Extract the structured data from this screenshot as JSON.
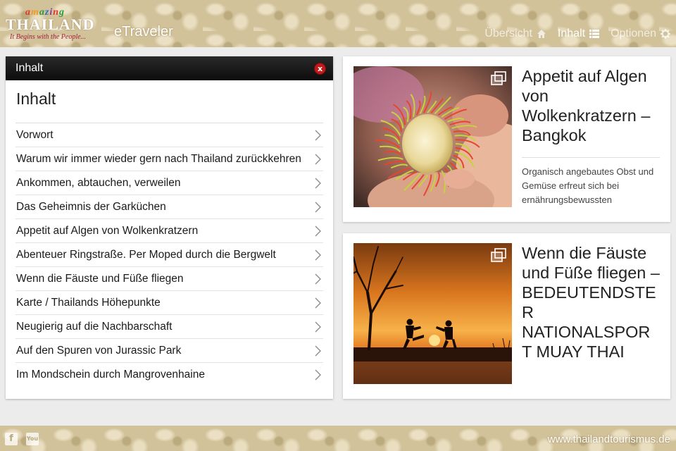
{
  "header": {
    "logo": {
      "amazing": "amazing",
      "brand": "THAILAND",
      "tagline": "It Begins with the People..."
    },
    "app_name": "eTraveler",
    "nav": [
      {
        "label": "Übersicht",
        "icon": "home-icon"
      },
      {
        "label": "Inhalt",
        "icon": "list-icon"
      },
      {
        "label": "Optionen",
        "icon": "gear-icon"
      }
    ]
  },
  "toc": {
    "bar_title": "Inhalt",
    "close_label": "x",
    "heading": "Inhalt",
    "items": [
      {
        "label": "Vorwort"
      },
      {
        "label": "Warum wir immer wieder gern nach Thailand zurückkehren"
      },
      {
        "label": "Ankommen, abtauchen, verweilen"
      },
      {
        "label": "Das Geheimnis der Garküchen"
      },
      {
        "label": "Appetit auf Algen von Wolkenkratzern"
      },
      {
        "label": "Abenteuer Ringstraße. Per Moped durch die Bergwelt"
      },
      {
        "label": "Wenn die Fäuste und Füße fliegen"
      },
      {
        "label": "Karte / Thailands Höhepunkte"
      },
      {
        "label": "Neugierig auf die Nachbarschaft"
      },
      {
        "label": "Auf den Spuren von Jurassic Park"
      },
      {
        "label": "Im Mondschein durch Mangrovenhaine"
      }
    ]
  },
  "cards": [
    {
      "title": "Appetit auf Algen von Wolkenkratzern – Bangkok",
      "description": "Organisch angebautes Obst und Gemüse erfreut sich bei ernährungsbewussten"
    },
    {
      "title": "Wenn die Fäuste und Füße fliegen – BEDEUTENDSTE R NATIONALSPOR T MUAY THAI"
    }
  ],
  "footer": {
    "facebook_icon": "f",
    "youtube_icon": "You",
    "url": "www.thailandtourismus.de"
  },
  "colors": {
    "ornament": "#d2c29a",
    "toc_bar": "#111111",
    "close_button": "#c01a1a",
    "tagline": "#a0203a"
  }
}
